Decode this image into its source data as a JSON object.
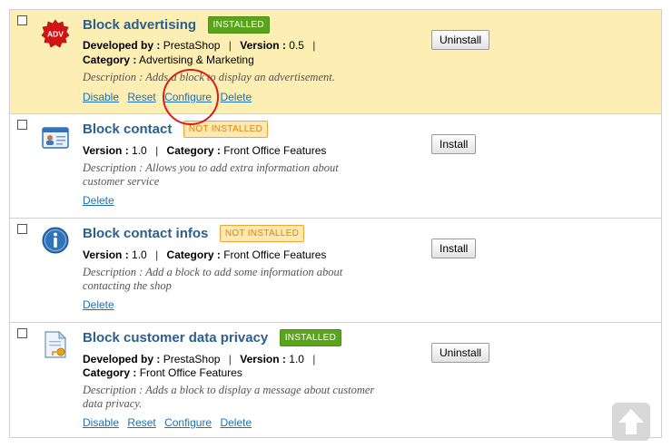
{
  "modules": [
    {
      "name": "Block advertising",
      "status": "INSTALLED",
      "developer_label": "Developed by :",
      "developer": "PrestaShop",
      "version_label": "Version :",
      "version": "0.5",
      "category_label": "Category :",
      "category": "Advertising & Marketing",
      "description": "Description : Adds a block to display an advertisement.",
      "button": "Uninstall",
      "actions": [
        "Disable",
        "Reset",
        "Configure",
        "Delete"
      ],
      "icon": "adv-icon"
    },
    {
      "name": "Block contact",
      "status": "NOT INSTALLED",
      "version_label": "Version :",
      "version": "1.0",
      "category_label": "Category :",
      "category": "Front Office Features",
      "description": "Description : Allows you to add extra information about customer service",
      "button": "Install",
      "actions": [
        "Delete"
      ],
      "icon": "contact-card-icon"
    },
    {
      "name": "Block contact infos",
      "status": "NOT INSTALLED",
      "version_label": "Version :",
      "version": "1.0",
      "category_label": "Category :",
      "category": "Front Office Features",
      "description": "Description : Add a block to add some information about contacting the shop",
      "button": "Install",
      "actions": [
        "Delete"
      ],
      "icon": "info-icon"
    },
    {
      "name": "Block customer data privacy",
      "status": "INSTALLED",
      "developer_label": "Developed by :",
      "developer": "PrestaShop",
      "version_label": "Version :",
      "version": "1.0",
      "category_label": "Category :",
      "category": "Front Office Features",
      "description": "Description : Adds a block to display a message about customer data privacy.",
      "button": "Uninstall",
      "actions": [
        "Disable",
        "Reset",
        "Configure",
        "Delete"
      ],
      "icon": "privacy-doc-key-icon"
    }
  ],
  "colors": {
    "highlight_row": "#fdeeb4",
    "title": "#2a5f8e",
    "installed_badge": "#59a41a",
    "not_installed_badge": "#fee8b3",
    "link": "#1f6fb7",
    "annotation_circle": "#d51e1e"
  },
  "scroll_top_icon": "arrow-up-icon"
}
